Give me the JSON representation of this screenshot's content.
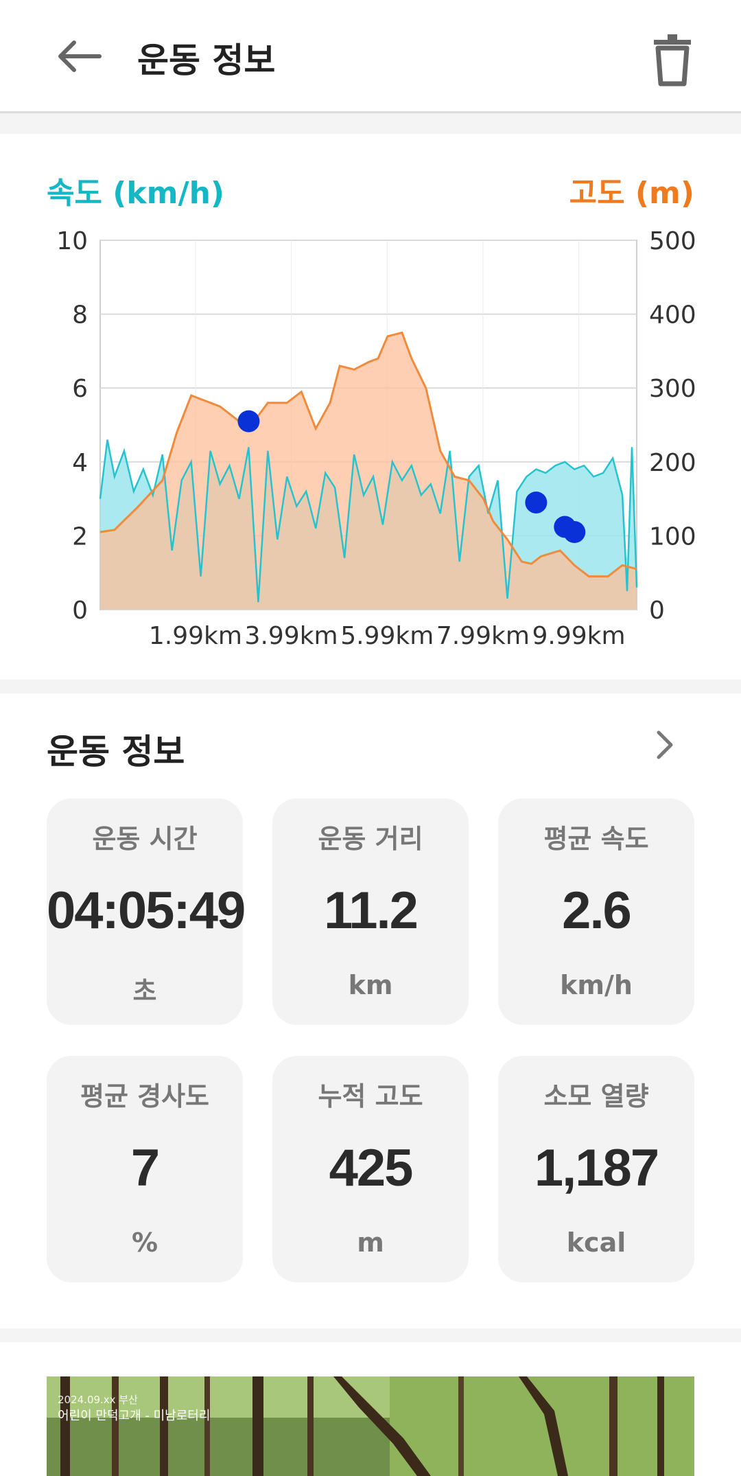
{
  "appbar": {
    "title": "운동 정보"
  },
  "chart": {
    "left_label": "속도 (km/h)",
    "right_label": "고도 (m)"
  },
  "chart_data": {
    "type": "area",
    "xlabel": "",
    "x_tick_labels": [
      "1.99km",
      "3.99km",
      "5.99km",
      "7.99km",
      "9.99km"
    ],
    "x_ticks_km": [
      1.99,
      3.99,
      5.99,
      7.99,
      9.99
    ],
    "xlim_km": [
      0,
      11.2
    ],
    "y_left": {
      "label": "속도 (km/h)",
      "ticks": [
        0,
        2,
        4,
        6,
        8,
        10
      ],
      "lim": [
        0,
        10
      ]
    },
    "y_right": {
      "label": "고도 (m)",
      "ticks": [
        0,
        100,
        200,
        300,
        400,
        500
      ],
      "lim": [
        0,
        500
      ]
    },
    "grid": true,
    "series": [
      {
        "name": "고도 (m)",
        "color": "#f08a3c",
        "fill": "#ffbf99",
        "x": [
          0,
          0.3,
          0.8,
          1.3,
          1.6,
          1.9,
          2.5,
          3.1,
          3.5,
          3.9,
          4.2,
          4.5,
          4.8,
          5.0,
          5.3,
          5.6,
          5.8,
          6.0,
          6.3,
          6.5,
          6.8,
          7.1,
          7.4,
          7.7,
          8.0,
          8.2,
          8.5,
          8.8,
          9.0,
          9.2,
          9.6,
          9.9,
          10.2,
          10.6,
          10.9,
          11.2
        ],
        "values": [
          105,
          108,
          140,
          175,
          240,
          290,
          275,
          245,
          280,
          280,
          295,
          245,
          280,
          330,
          325,
          335,
          340,
          370,
          375,
          340,
          300,
          215,
          180,
          175,
          150,
          120,
          95,
          65,
          62,
          72,
          80,
          60,
          45,
          45,
          60,
          55
        ]
      },
      {
        "name": "속도 (km/h)",
        "color": "#26c3cf",
        "fill": "#9be5ec",
        "x": [
          0,
          0.15,
          0.3,
          0.5,
          0.7,
          0.9,
          1.1,
          1.3,
          1.5,
          1.7,
          1.9,
          2.1,
          2.3,
          2.5,
          2.7,
          2.9,
          3.1,
          3.3,
          3.5,
          3.7,
          3.9,
          4.1,
          4.3,
          4.5,
          4.7,
          4.9,
          5.1,
          5.3,
          5.5,
          5.7,
          5.9,
          6.1,
          6.3,
          6.5,
          6.7,
          6.9,
          7.1,
          7.3,
          7.5,
          7.7,
          7.9,
          8.1,
          8.3,
          8.5,
          8.7,
          8.9,
          9.1,
          9.3,
          9.5,
          9.7,
          9.9,
          10.1,
          10.3,
          10.5,
          10.7,
          10.9,
          11.0,
          11.1,
          11.2
        ],
        "values": [
          3.0,
          4.6,
          3.6,
          4.3,
          3.2,
          3.8,
          3.1,
          4.2,
          1.6,
          3.5,
          4.0,
          0.9,
          4.3,
          3.4,
          3.9,
          3.0,
          4.4,
          0.2,
          4.3,
          1.9,
          3.6,
          2.8,
          3.2,
          2.2,
          3.7,
          3.3,
          1.4,
          4.2,
          3.1,
          3.6,
          2.3,
          4.0,
          3.5,
          3.9,
          3.1,
          3.4,
          2.6,
          4.3,
          1.3,
          3.6,
          3.9,
          2.6,
          3.5,
          0.3,
          3.2,
          3.6,
          3.8,
          3.7,
          3.9,
          4.0,
          3.8,
          3.9,
          3.6,
          3.7,
          4.1,
          3.1,
          0.5,
          4.4,
          0.6
        ]
      }
    ],
    "markers_km": [
      3.1,
      9.1,
      9.7,
      9.9
    ],
    "markers_elevation_m": [
      255,
      145,
      112,
      105
    ],
    "marker_color": "#0a31d8"
  },
  "section": {
    "title": "운동 정보"
  },
  "stats": [
    {
      "label": "운동 시간",
      "value": "04:05:49",
      "unit": "초"
    },
    {
      "label": "운동 거리",
      "value": "11.2",
      "unit": "km"
    },
    {
      "label": "평균 속도",
      "value": "2.6",
      "unit": "km/h"
    },
    {
      "label": "평균 경사도",
      "value": "7",
      "unit": "%"
    },
    {
      "label": "누적 고도",
      "value": "425",
      "unit": "m"
    },
    {
      "label": "소모 열량",
      "value": "1,187",
      "unit": "kcal"
    }
  ],
  "photo": {
    "caption_small": "2024.09.xx 부산",
    "caption": "어린이 만덕고개 - 미남로터리"
  }
}
